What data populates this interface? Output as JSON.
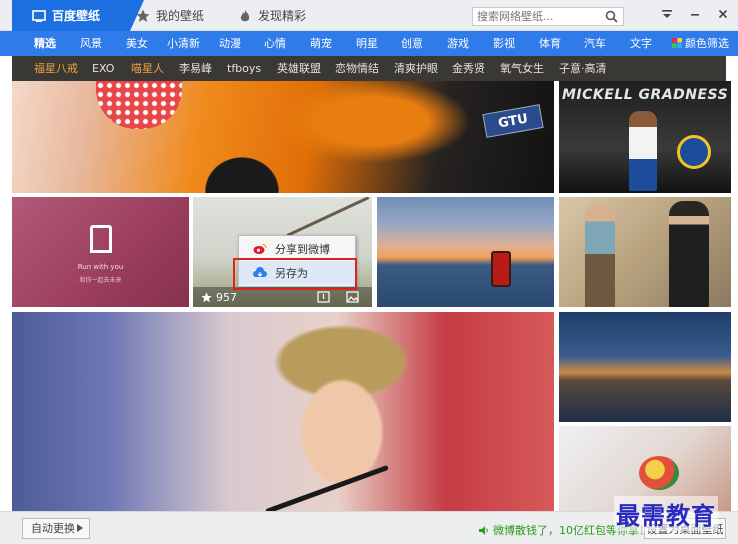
{
  "titlebar": {
    "tabs": [
      {
        "label": "百度壁纸",
        "icon": "wallpaper-icon"
      },
      {
        "label": "我的壁纸",
        "icon": "star-icon"
      },
      {
        "label": "发现精彩",
        "icon": "flame-icon"
      }
    ],
    "search_placeholder": "搜索网络壁纸...",
    "window_controls": [
      "menu-icon",
      "minimize-icon",
      "close-icon"
    ]
  },
  "categories": [
    "精选",
    "风景",
    "美女",
    "小清新",
    "动漫",
    "心情",
    "萌宠",
    "明星",
    "创意",
    "游戏",
    "影视",
    "体育",
    "汽车",
    "文字",
    "颜色筛选"
  ],
  "selected_category": "精选",
  "tags": [
    "福星八戒",
    "EXO",
    "喵星人",
    "李易峰",
    "tfboys",
    "英雄联盟",
    "恋物情结",
    "清爽护眼",
    "金秀贤",
    "氧气女生",
    "子意·高清"
  ],
  "gallery": {
    "bball_text": "MICKELL GRADNESS",
    "car_plate": "GTU",
    "pink_line1": "Run with you",
    "pink_line2": "和你一起去未来",
    "likes": "957"
  },
  "context_menu": {
    "share_label": "分享到微博",
    "save_label": "另存为"
  },
  "bottombar": {
    "auto_change": "自动更换",
    "promo": "微博散钱了，10亿红包等你拿！",
    "set_wallpaper": "设置为桌面壁纸"
  },
  "watermark": "最需教育",
  "colors": {
    "accent": "#1b6fe0",
    "catbar": "#2f7be9",
    "tagbar": "#3a3835",
    "highlight": "#e0211c",
    "promo": "#2b9a1a"
  }
}
